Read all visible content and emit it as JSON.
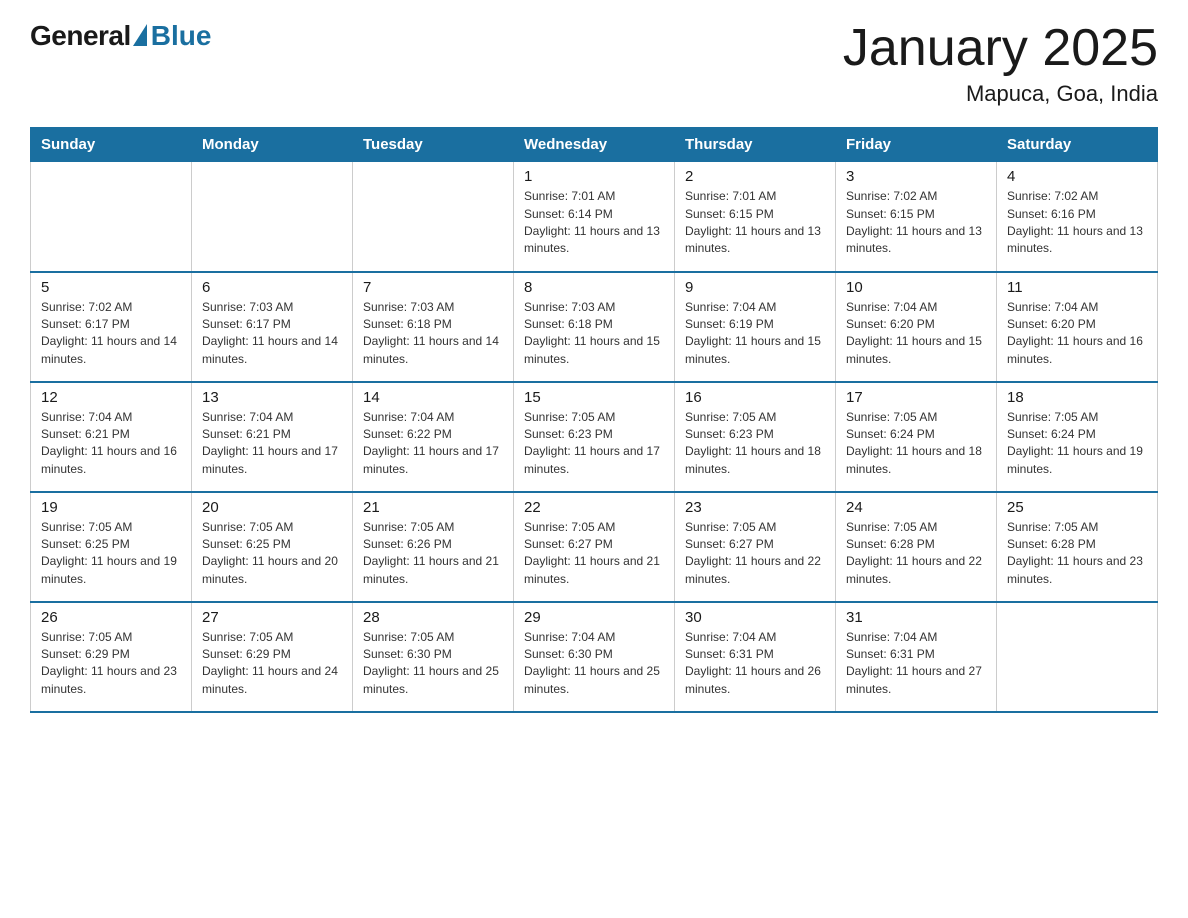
{
  "logo": {
    "general": "General",
    "blue": "Blue"
  },
  "title": "January 2025",
  "subtitle": "Mapuca, Goa, India",
  "days_of_week": [
    "Sunday",
    "Monday",
    "Tuesday",
    "Wednesday",
    "Thursday",
    "Friday",
    "Saturday"
  ],
  "weeks": [
    [
      {
        "day": "",
        "info": ""
      },
      {
        "day": "",
        "info": ""
      },
      {
        "day": "",
        "info": ""
      },
      {
        "day": "1",
        "info": "Sunrise: 7:01 AM\nSunset: 6:14 PM\nDaylight: 11 hours and 13 minutes."
      },
      {
        "day": "2",
        "info": "Sunrise: 7:01 AM\nSunset: 6:15 PM\nDaylight: 11 hours and 13 minutes."
      },
      {
        "day": "3",
        "info": "Sunrise: 7:02 AM\nSunset: 6:15 PM\nDaylight: 11 hours and 13 minutes."
      },
      {
        "day": "4",
        "info": "Sunrise: 7:02 AM\nSunset: 6:16 PM\nDaylight: 11 hours and 13 minutes."
      }
    ],
    [
      {
        "day": "5",
        "info": "Sunrise: 7:02 AM\nSunset: 6:17 PM\nDaylight: 11 hours and 14 minutes."
      },
      {
        "day": "6",
        "info": "Sunrise: 7:03 AM\nSunset: 6:17 PM\nDaylight: 11 hours and 14 minutes."
      },
      {
        "day": "7",
        "info": "Sunrise: 7:03 AM\nSunset: 6:18 PM\nDaylight: 11 hours and 14 minutes."
      },
      {
        "day": "8",
        "info": "Sunrise: 7:03 AM\nSunset: 6:18 PM\nDaylight: 11 hours and 15 minutes."
      },
      {
        "day": "9",
        "info": "Sunrise: 7:04 AM\nSunset: 6:19 PM\nDaylight: 11 hours and 15 minutes."
      },
      {
        "day": "10",
        "info": "Sunrise: 7:04 AM\nSunset: 6:20 PM\nDaylight: 11 hours and 15 minutes."
      },
      {
        "day": "11",
        "info": "Sunrise: 7:04 AM\nSunset: 6:20 PM\nDaylight: 11 hours and 16 minutes."
      }
    ],
    [
      {
        "day": "12",
        "info": "Sunrise: 7:04 AM\nSunset: 6:21 PM\nDaylight: 11 hours and 16 minutes."
      },
      {
        "day": "13",
        "info": "Sunrise: 7:04 AM\nSunset: 6:21 PM\nDaylight: 11 hours and 17 minutes."
      },
      {
        "day": "14",
        "info": "Sunrise: 7:04 AM\nSunset: 6:22 PM\nDaylight: 11 hours and 17 minutes."
      },
      {
        "day": "15",
        "info": "Sunrise: 7:05 AM\nSunset: 6:23 PM\nDaylight: 11 hours and 17 minutes."
      },
      {
        "day": "16",
        "info": "Sunrise: 7:05 AM\nSunset: 6:23 PM\nDaylight: 11 hours and 18 minutes."
      },
      {
        "day": "17",
        "info": "Sunrise: 7:05 AM\nSunset: 6:24 PM\nDaylight: 11 hours and 18 minutes."
      },
      {
        "day": "18",
        "info": "Sunrise: 7:05 AM\nSunset: 6:24 PM\nDaylight: 11 hours and 19 minutes."
      }
    ],
    [
      {
        "day": "19",
        "info": "Sunrise: 7:05 AM\nSunset: 6:25 PM\nDaylight: 11 hours and 19 minutes."
      },
      {
        "day": "20",
        "info": "Sunrise: 7:05 AM\nSunset: 6:25 PM\nDaylight: 11 hours and 20 minutes."
      },
      {
        "day": "21",
        "info": "Sunrise: 7:05 AM\nSunset: 6:26 PM\nDaylight: 11 hours and 21 minutes."
      },
      {
        "day": "22",
        "info": "Sunrise: 7:05 AM\nSunset: 6:27 PM\nDaylight: 11 hours and 21 minutes."
      },
      {
        "day": "23",
        "info": "Sunrise: 7:05 AM\nSunset: 6:27 PM\nDaylight: 11 hours and 22 minutes."
      },
      {
        "day": "24",
        "info": "Sunrise: 7:05 AM\nSunset: 6:28 PM\nDaylight: 11 hours and 22 minutes."
      },
      {
        "day": "25",
        "info": "Sunrise: 7:05 AM\nSunset: 6:28 PM\nDaylight: 11 hours and 23 minutes."
      }
    ],
    [
      {
        "day": "26",
        "info": "Sunrise: 7:05 AM\nSunset: 6:29 PM\nDaylight: 11 hours and 23 minutes."
      },
      {
        "day": "27",
        "info": "Sunrise: 7:05 AM\nSunset: 6:29 PM\nDaylight: 11 hours and 24 minutes."
      },
      {
        "day": "28",
        "info": "Sunrise: 7:05 AM\nSunset: 6:30 PM\nDaylight: 11 hours and 25 minutes."
      },
      {
        "day": "29",
        "info": "Sunrise: 7:04 AM\nSunset: 6:30 PM\nDaylight: 11 hours and 25 minutes."
      },
      {
        "day": "30",
        "info": "Sunrise: 7:04 AM\nSunset: 6:31 PM\nDaylight: 11 hours and 26 minutes."
      },
      {
        "day": "31",
        "info": "Sunrise: 7:04 AM\nSunset: 6:31 PM\nDaylight: 11 hours and 27 minutes."
      },
      {
        "day": "",
        "info": ""
      }
    ]
  ]
}
